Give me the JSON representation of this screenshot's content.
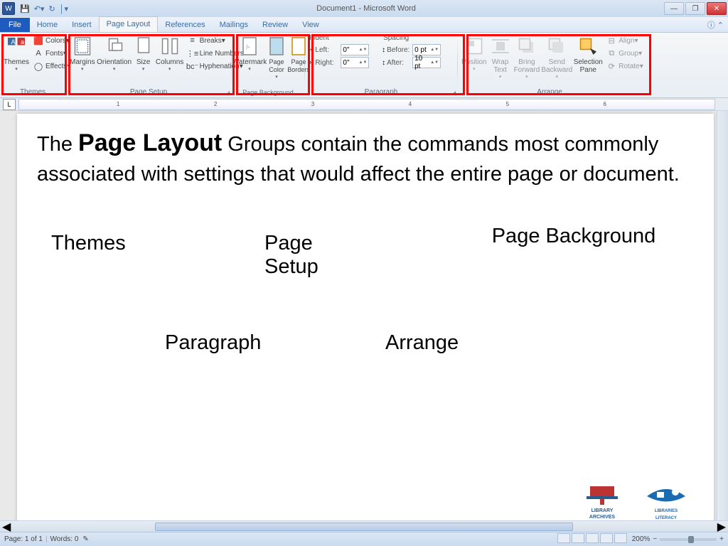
{
  "titlebar": {
    "app_icon": "W",
    "title": "Document1 - Microsoft Word"
  },
  "tabs": {
    "file": "File",
    "items": [
      "Home",
      "Insert",
      "Page Layout",
      "References",
      "Mailings",
      "Review",
      "View"
    ],
    "active_index": 2
  },
  "ribbon": {
    "themes": {
      "label": "Themes",
      "themes_btn": "Themes",
      "colors": "Colors",
      "fonts": "Fonts",
      "effects": "Effects"
    },
    "page_setup": {
      "label": "Page Setup",
      "margins": "Margins",
      "orientation": "Orientation",
      "size": "Size",
      "columns": "Columns",
      "breaks": "Breaks",
      "line_numbers": "Line Numbers",
      "hyphenation": "Hyphenation"
    },
    "page_background": {
      "label": "Page Background",
      "watermark": "Watermark",
      "page_color": "Page Color",
      "page_borders": "Page Borders"
    },
    "paragraph": {
      "label": "Paragraph",
      "indent_label": "Indent",
      "spacing_label": "Spacing",
      "left_label": "Left:",
      "right_label": "Right:",
      "before_label": "Before:",
      "after_label": "After:",
      "left_value": "0\"",
      "right_value": "0\"",
      "before_value": "0 pt",
      "after_value": "10 pt"
    },
    "arrange": {
      "label": "Arrange",
      "position": "Position",
      "wrap_text": "Wrap Text",
      "bring_forward": "Bring Forward",
      "send_backward": "Send Backward",
      "selection_pane": "Selection Pane",
      "align": "Align",
      "group": "Group",
      "rotate": "Rotate"
    }
  },
  "document": {
    "text_pre": "The ",
    "text_bold": "Page Layout",
    "text_post": " Groups contain the commands most commonly associated with settings that would affect the entire page or document.",
    "labels": {
      "themes": "Themes",
      "page_setup": "Page Setup",
      "page_background": "Page Background",
      "paragraph": "Paragraph",
      "arrange": "Arrange"
    },
    "logo1_line1": "LIBRARY",
    "logo1_line2": "ARCHIVES",
    "logo2_line1": "LIBRARIES",
    "logo2_line2": "LITERACY"
  },
  "statusbar": {
    "page": "Page: 1 of 1",
    "words": "Words: 0",
    "zoom": "200%"
  }
}
